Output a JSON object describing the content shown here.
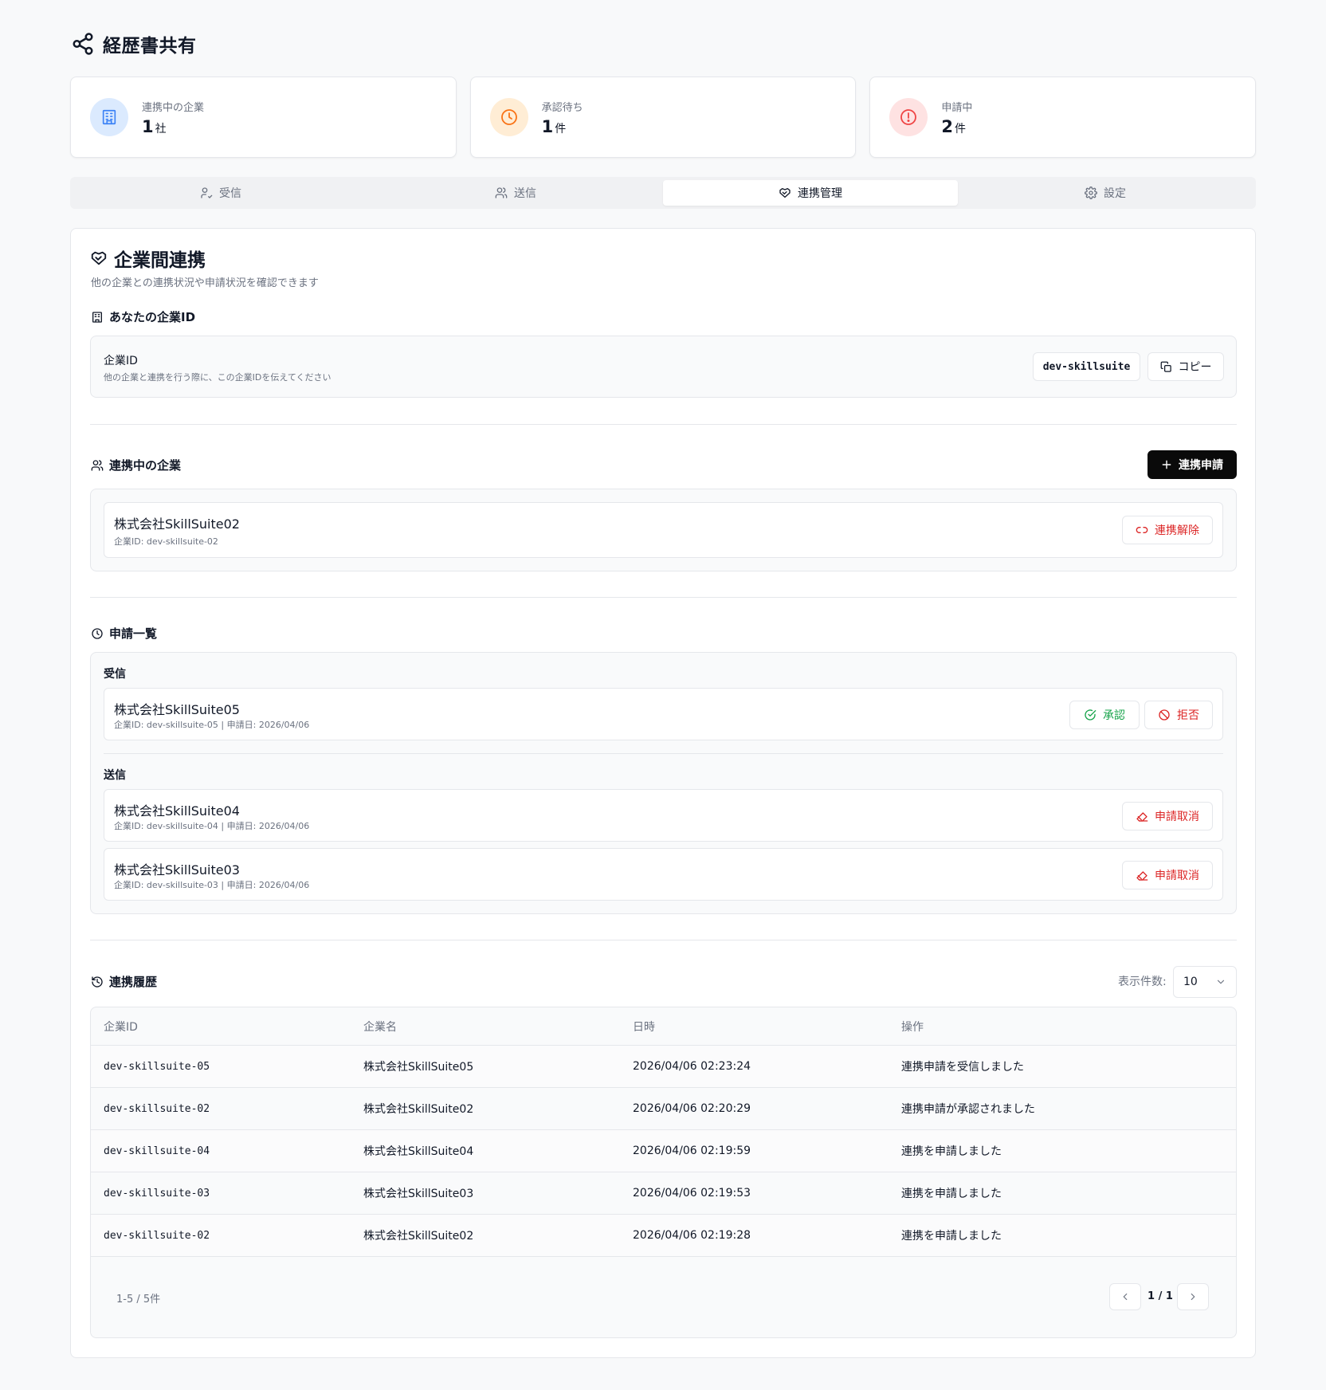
{
  "app": {
    "title": "経歴書共有"
  },
  "stats": [
    {
      "label": "連携中の企業",
      "value": "1",
      "unit": "社",
      "color": "#3b82f6",
      "bg": "#dbeafe",
      "icon": "building-icon"
    },
    {
      "label": "承認待ち",
      "value": "1",
      "unit": "件",
      "color": "#f97316",
      "bg": "#ffedd5",
      "icon": "clock-icon"
    },
    {
      "label": "申請中",
      "value": "2",
      "unit": "件",
      "color": "#ef4444",
      "bg": "#fee2e2",
      "icon": "alert-circle-icon"
    }
  ],
  "tabs": [
    {
      "label": "受信",
      "icon": "user-check-icon",
      "active": false
    },
    {
      "label": "送信",
      "icon": "users-icon",
      "active": false
    },
    {
      "label": "連携管理",
      "icon": "handshake-icon",
      "active": true
    },
    {
      "label": "設定",
      "icon": "gear-icon",
      "active": false
    }
  ],
  "main": {
    "title": "企業間連携",
    "description": "他の企業との連携状況や申請状況を確認できます"
  },
  "company_id_section": {
    "title": "あなたの企業ID",
    "label": "企業ID",
    "help": "他の企業と連携を行う際に、この企業IDを伝えてください",
    "value": "dev-skillsuite",
    "copy_label": "コピー"
  },
  "partners_section": {
    "title": "連携中の企業",
    "add_label": "連携申請",
    "items": [
      {
        "name": "株式会社SkillSuite02",
        "sub": "企業ID: dev-skillsuite-02",
        "action": "連携解除"
      }
    ]
  },
  "requests_section": {
    "title": "申請一覧",
    "received_label": "受信",
    "sent_label": "送信",
    "approve_label": "承認",
    "reject_label": "拒否",
    "cancel_label": "申請取消",
    "received": [
      {
        "name": "株式会社SkillSuite05",
        "sub": "企業ID: dev-skillsuite-05 | 申請日: 2026/04/06"
      }
    ],
    "sent": [
      {
        "name": "株式会社SkillSuite04",
        "sub": "企業ID: dev-skillsuite-04 | 申請日: 2026/04/06"
      },
      {
        "name": "株式会社SkillSuite03",
        "sub": "企業ID: dev-skillsuite-03 | 申請日: 2026/04/06"
      }
    ]
  },
  "history_section": {
    "title": "連携履歴",
    "page_size_label": "表示件数:",
    "page_size": "10",
    "columns": [
      "企業ID",
      "企業名",
      "日時",
      "操作"
    ],
    "rows": [
      [
        "dev-skillsuite-05",
        "株式会社SkillSuite05",
        "2026/04/06 02:23:24",
        "連携申請を受信しました"
      ],
      [
        "dev-skillsuite-02",
        "株式会社SkillSuite02",
        "2026/04/06 02:20:29",
        "連携申請が承認されました"
      ],
      [
        "dev-skillsuite-04",
        "株式会社SkillSuite04",
        "2026/04/06 02:19:59",
        "連携を申請しました"
      ],
      [
        "dev-skillsuite-03",
        "株式会社SkillSuite03",
        "2026/04/06 02:19:53",
        "連携を申請しました"
      ],
      [
        "dev-skillsuite-02",
        "株式会社SkillSuite02",
        "2026/04/06 02:19:28",
        "連携を申請しました"
      ]
    ],
    "range_text": "1-5 / 5件",
    "page_text": "1 / 1"
  }
}
